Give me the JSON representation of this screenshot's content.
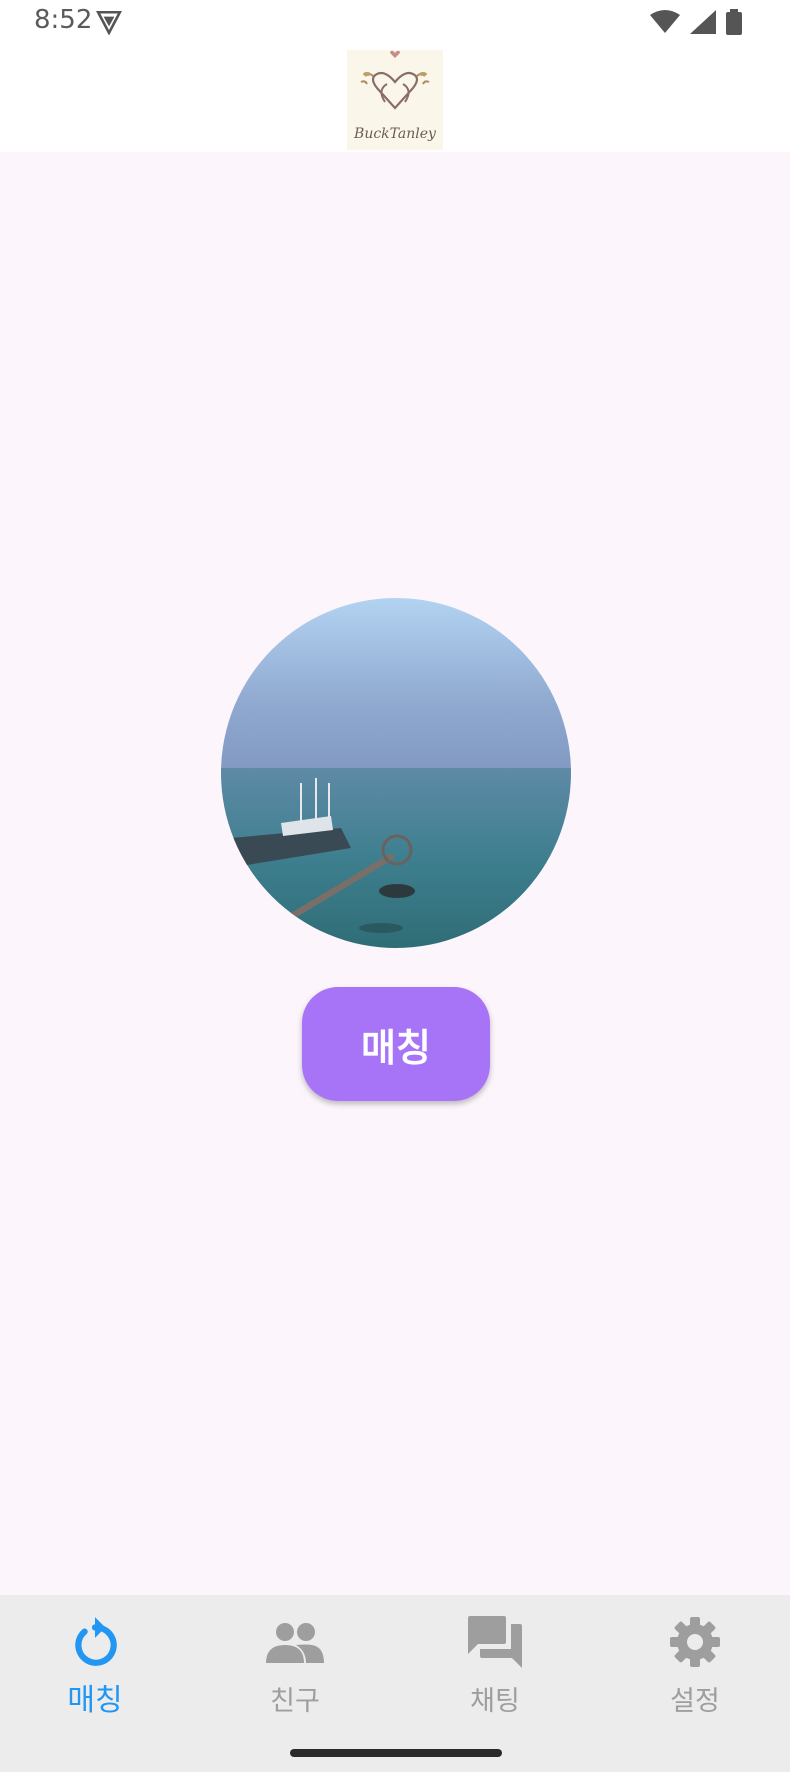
{
  "status_bar": {
    "time": "8:52"
  },
  "header": {
    "logo_text": "BuckTanley"
  },
  "main": {
    "match_button_label": "매칭"
  },
  "bottom_nav": {
    "items": [
      {
        "label": "매칭",
        "icon": "refresh-icon",
        "active": true
      },
      {
        "label": "친구",
        "icon": "people-icon",
        "active": false
      },
      {
        "label": "채팅",
        "icon": "chat-icon",
        "active": false
      },
      {
        "label": "설정",
        "icon": "gear-icon",
        "active": false
      }
    ]
  },
  "colors": {
    "accent": "#a874f7",
    "nav_active": "#2196f3",
    "nav_inactive": "#9e9e9e",
    "background": "#fcf5fc"
  }
}
